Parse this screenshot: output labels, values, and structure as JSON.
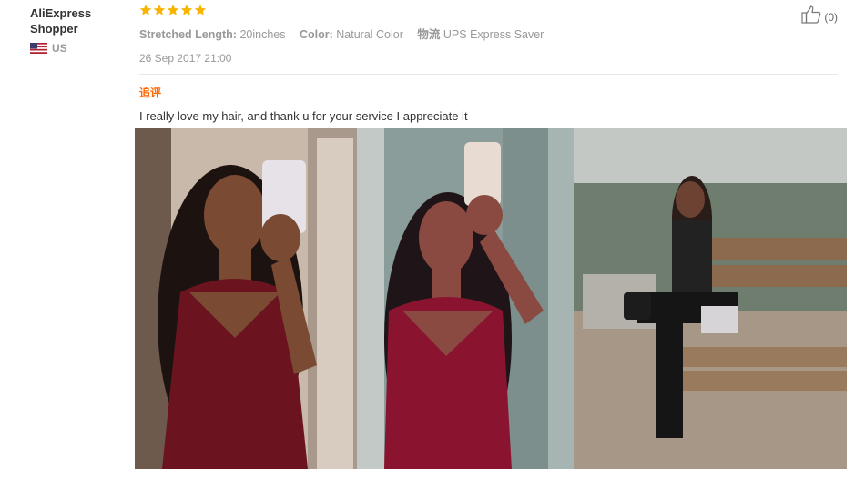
{
  "user": {
    "name": "AliExpress Shopper",
    "country": "US",
    "flag_icon": "us-flag-icon"
  },
  "rating": {
    "stars": 5,
    "max": 5,
    "color": "#f7b500"
  },
  "attributes": [
    {
      "key": "Stretched Length:",
      "value": "20inches"
    },
    {
      "key": "Color:",
      "value": "Natural Color"
    },
    {
      "key": "物流",
      "value": "UPS Express Saver"
    }
  ],
  "date": "26 Sep 2017 21:00",
  "helpful": {
    "icon": "thumbs-up-icon",
    "count_label": "(0)"
  },
  "followup_label": "追评",
  "review_text": "I really love my hair, and thank u for your service I appreciate it",
  "photos": [
    {
      "icon": "review-photo-1"
    },
    {
      "icon": "review-photo-2"
    },
    {
      "icon": "review-photo-3"
    }
  ],
  "colors": {
    "accent": "#ff6600",
    "muted": "#999999",
    "text": "#333333"
  }
}
